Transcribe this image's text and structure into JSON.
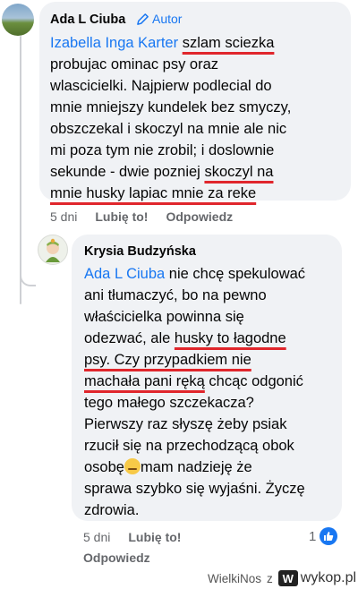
{
  "comment": {
    "author": "Ada L Ciuba",
    "badge": "Autor",
    "mention": "Izabella Inga Karter",
    "lines": [
      {
        "pre": " ",
        "hl": "szlam sciezka",
        "post": ""
      },
      {
        "pre": "probujac ominac psy oraz",
        "hl": "",
        "post": ""
      },
      {
        "pre": "wlascicielki. Najpierw podlecial do",
        "hl": "",
        "post": ""
      },
      {
        "pre": "mnie mniejszy kundelek bez smyczy,",
        "hl": "",
        "post": ""
      },
      {
        "pre": "obszczekal i skoczyl na mnie ale nic",
        "hl": "",
        "post": ""
      },
      {
        "pre": "mi poza tym nie zrobil; i doslownie",
        "hl": "",
        "post": ""
      },
      {
        "pre": "sekunde - dwie pozniej ",
        "hl": "skoczyl na",
        "post": ""
      },
      {
        "pre": "",
        "hl": "mnie husky lapiac mnie za reke",
        "post": ""
      }
    ],
    "time": "5 dni",
    "like": "Lubię to!",
    "reply": "Odpowiedz"
  },
  "reply": {
    "author": "Krysia Budzyńska",
    "mention": "Ada L Ciuba",
    "lines": [
      {
        "pre": " nie chcę spekulować",
        "hl": "",
        "post": ""
      },
      {
        "pre": "ani tłumaczyć, bo na pewno",
        "hl": "",
        "post": ""
      },
      {
        "pre": "właścicielka powinna się",
        "hl": "",
        "post": ""
      },
      {
        "pre": "odezwać, ale ",
        "hl": "husky to łagodne",
        "post": ""
      },
      {
        "pre": "",
        "hl": "psy. Czy przypadkiem nie",
        "post": ""
      },
      {
        "pre": "",
        "hl": "machała pani ręką",
        "post": " chcąc odgonić"
      },
      {
        "pre": "tego małego szczekacza?",
        "hl": "",
        "post": ""
      },
      {
        "pre": "Pierwszy raz słyszę żeby psiak",
        "hl": "",
        "post": ""
      },
      {
        "pre": "rzucił się na przechodzącą obok",
        "hl": "",
        "post": ""
      },
      {
        "pre": "osobę",
        "hl": "",
        "post": "mam nadzieję że",
        "emoji": true
      },
      {
        "pre": "sprawa szybko się wyjaśni. Życzę",
        "hl": "",
        "post": ""
      },
      {
        "pre": "zdrowia.",
        "hl": "",
        "post": ""
      }
    ],
    "time": "5 dni",
    "like": "Lubię to!",
    "reply": "Odpowiedz",
    "reaction_count": "1"
  },
  "watermark": {
    "user": "WielkiNos",
    "sep": "z",
    "site": "wykop.pl",
    "logo_letter": "W"
  },
  "colors": {
    "accent": "#1877f2",
    "underline": "#e0262c",
    "bubble": "#f0f2f5",
    "muted": "#65676b"
  },
  "icons": {
    "badge": "pencil-icon",
    "reaction": "thumbs-up-icon",
    "emoji": "thinking-face-icon"
  }
}
